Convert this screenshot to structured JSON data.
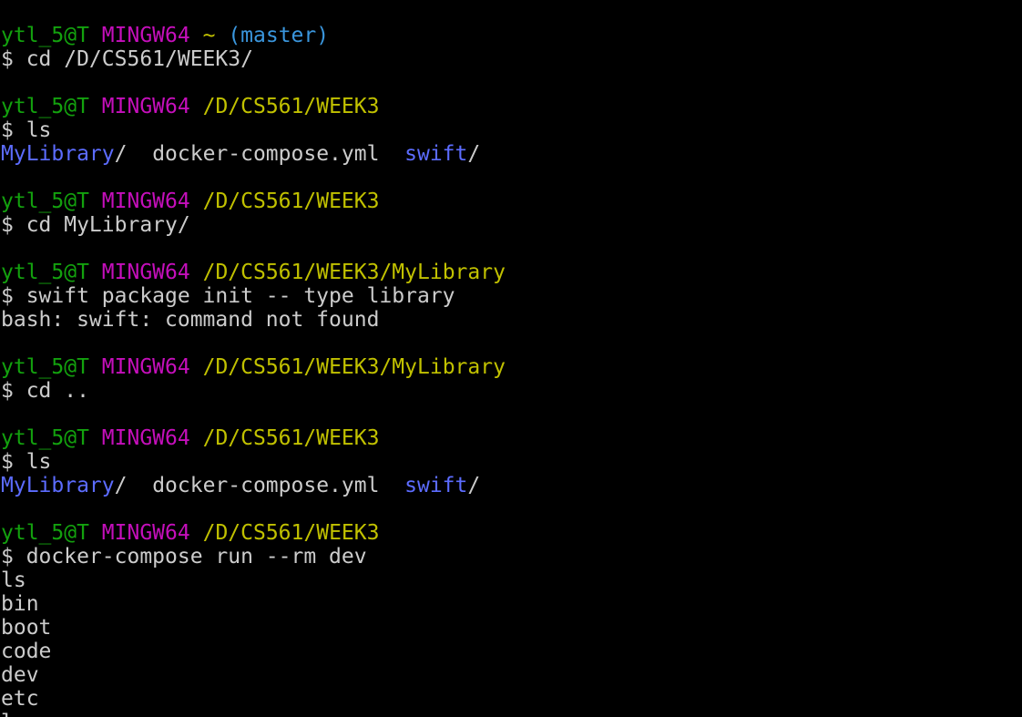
{
  "colors": {
    "background": "#000000",
    "text": "#cccccc",
    "user": "#13a10e",
    "host": "#c50fbb",
    "path": "#c1c100",
    "branch": "#3a96dd",
    "directory": "#5c6cff"
  },
  "prompts": [
    {
      "user": "ytl_5@T",
      "host": "MINGW64",
      "path": "~",
      "branch": "(master)",
      "command": "$ cd /D/CS561/WEEK3/"
    },
    {
      "user": "ytl_5@T",
      "host": "MINGW64",
      "path": "/D/CS561/WEEK3",
      "command": "$ ls"
    },
    {
      "user": "ytl_5@T",
      "host": "MINGW64",
      "path": "/D/CS561/WEEK3",
      "command": "$ cd MyLibrary/"
    },
    {
      "user": "ytl_5@T",
      "host": "MINGW64",
      "path": "/D/CS561/WEEK3/MyLibrary",
      "command": "$ swift package init -- type library"
    },
    {
      "user": "ytl_5@T",
      "host": "MINGW64",
      "path": "/D/CS561/WEEK3/MyLibrary",
      "command": "$ cd .."
    },
    {
      "user": "ytl_5@T",
      "host": "MINGW64",
      "path": "/D/CS561/WEEK3",
      "command": "$ ls"
    },
    {
      "user": "ytl_5@T",
      "host": "MINGW64",
      "path": "/D/CS561/WEEK3",
      "command": "$ docker-compose run --rm dev"
    }
  ],
  "ls_output_1": {
    "dir1": "MyLibrary",
    "slash1": "/",
    "file": "docker-compose.yml",
    "dir2": "swift",
    "slash2": "/"
  },
  "error_output": "bash: swift: command not found",
  "ls_output_2": {
    "dir1": "MyLibrary",
    "slash1": "/",
    "file": "docker-compose.yml",
    "dir2": "swift",
    "slash2": "/"
  },
  "container_output": [
    "ls",
    "bin",
    "boot",
    "code",
    "dev",
    "etc",
    "l"
  ]
}
